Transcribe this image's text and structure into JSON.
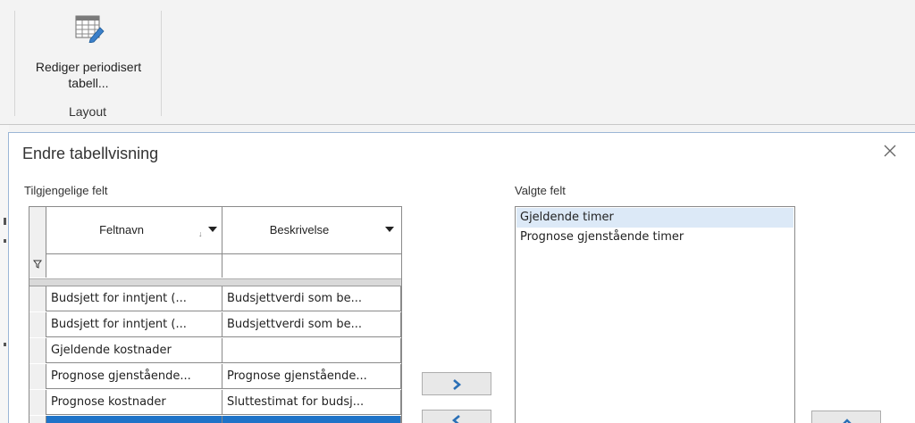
{
  "ribbon": {
    "button_line1": "Rediger periodisert",
    "button_line2": "tabell...",
    "group_label": "Layout",
    "icon": "edit-table-icon"
  },
  "dialog": {
    "title": "Endre tabellvisning",
    "close_icon": "close-icon",
    "available_label": "Tilgjengelige felt",
    "selected_label": "Valgte felt"
  },
  "grid": {
    "columns": [
      "Feltnavn",
      "Beskrivelse"
    ],
    "sort_indicator": "↓",
    "filter_icon": "filter-icon",
    "rows": [
      {
        "name": "Budsjett for inntjent (...",
        "desc": "Budsjettverdi som be..."
      },
      {
        "name": "Budsjett for inntjent (...",
        "desc": "Budsjettverdi som be..."
      },
      {
        "name": "Gjeldende kostnader",
        "desc": ""
      },
      {
        "name": "Prognose gjenstående...",
        "desc": "Prognose gjenstående..."
      },
      {
        "name": "Prognose kostnader",
        "desc": "Sluttestimat for budsj..."
      }
    ]
  },
  "selected_fields": {
    "items": [
      "Gjeldende timer",
      "Prognose gjenstående timer"
    ],
    "active_index": 0
  },
  "move_buttons": {
    "add_icon": "chevron-right-icon",
    "remove_icon": "chevron-left-icon",
    "up_icon": "chevron-up-icon"
  },
  "colors": {
    "accent": "#1e73c8",
    "selection": "#dce9f7",
    "arrow": "#2a6fb6"
  }
}
